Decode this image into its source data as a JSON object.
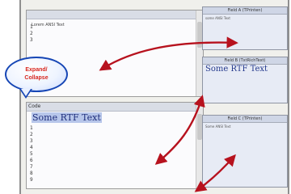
{
  "top_editor": {
    "header_label": "",
    "content_first_line": "Lorem ANSI Text",
    "line_numbers": [
      "1",
      "2",
      "3"
    ]
  },
  "bottom_editor": {
    "header_label": "Code",
    "content_first_line": "Some RTF Text",
    "line_numbers": [
      "1",
      "2",
      "3",
      "4",
      "5",
      "6",
      "7",
      "8",
      "9"
    ]
  },
  "callout": {
    "line1": "Expand/",
    "line2": "Collapse"
  },
  "right_panels": {
    "panel_a": {
      "title": "Field A (TPrinten)",
      "content": "some ANSI Text"
    },
    "panel_b": {
      "title": "Field B (TxtRichText)",
      "content": "Some RTF Text"
    },
    "panel_c": {
      "title": "Field C (TPrinten)",
      "content": "Some ANSI Text"
    }
  },
  "colors": {
    "arrow": "#b7121e",
    "callout_border": "#1646b5",
    "callout_text": "#d7261e"
  }
}
